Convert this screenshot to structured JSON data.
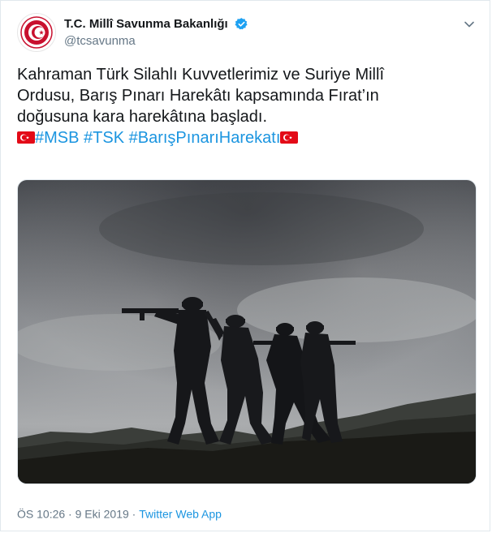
{
  "account": {
    "display_name": "T.C. Millî Savunma Bakanlığı",
    "handle": "@tcsavunma",
    "avatar_icon": "ministry-emblem-icon",
    "verified_icon": "verified-badge-icon"
  },
  "tweet": {
    "line1": "Kahraman Türk Silahlı Kuvvetlerimiz ve Suriye Millî",
    "line2": "Ordusu, Barış Pınarı Harekâtı kapsamında Fırat’ın",
    "line3": "doğusuna kara harekâtına başladı.",
    "hashtags": [
      "#MSB",
      "#TSK",
      "#BarışPınarıHarekatı"
    ],
    "flag_icon": "turkish-flag-icon"
  },
  "footer": {
    "time": "ÖS 10:26",
    "separator": "·",
    "date": "9 Eki 2019",
    "source": "Twitter Web App"
  },
  "colors": {
    "link": "#1b95e0",
    "muted": "#657786",
    "text": "#14171a",
    "flag": "#e30a17",
    "verified": "#1da1f2"
  }
}
